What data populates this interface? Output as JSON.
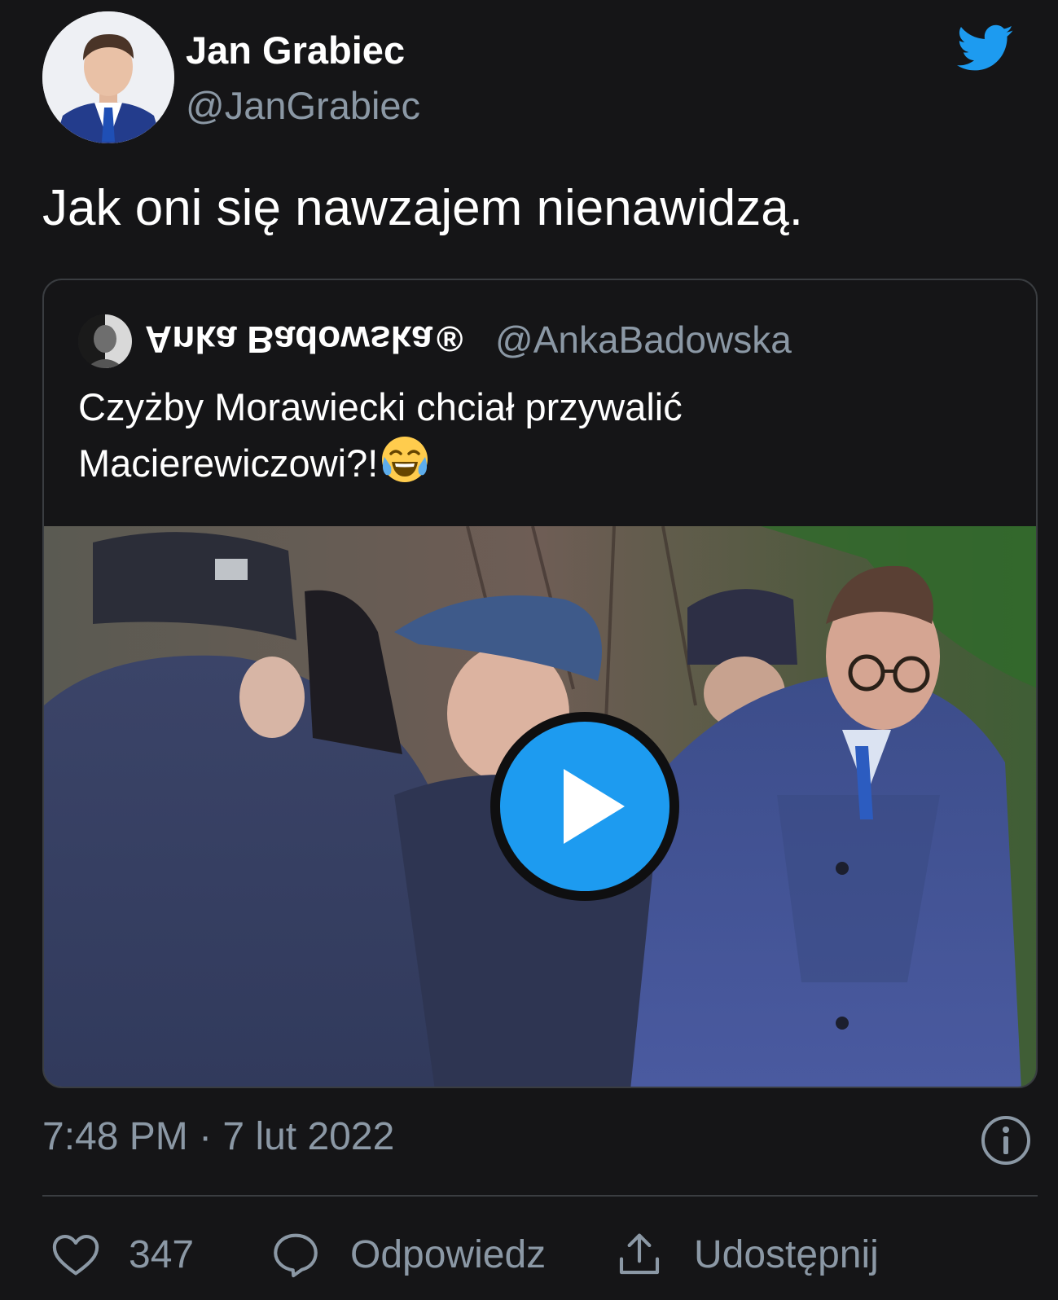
{
  "author": {
    "name": "Jan Grabiec",
    "handle": "@JanGrabiec"
  },
  "tweet": {
    "text": "Jak oni się nawzajem nienawidzą."
  },
  "quoted": {
    "name": "Anka Badowska",
    "registered": "®",
    "handle": "@AnkaBadowska",
    "text_line1": "Czyżby Morawiecki chciał przywalić",
    "text_line2": "Macierewiczowi?!",
    "emoji": "face-with-tears-of-joy"
  },
  "meta": {
    "timestamp": "7:48 PM · 7 lut 2022"
  },
  "actions": {
    "like_count": "347",
    "reply_label": "Odpowiedz",
    "share_label": "Udostępnij"
  },
  "icons": {
    "brand": "twitter-bird-icon",
    "play": "play-icon",
    "info": "info-icon",
    "like": "heart-icon",
    "reply": "speech-bubble-icon",
    "share": "share-upload-icon"
  },
  "colors": {
    "background": "#151517",
    "twitter_blue": "#1d9bf0",
    "secondary_text": "#8b98a5",
    "border": "#3a3d41"
  }
}
